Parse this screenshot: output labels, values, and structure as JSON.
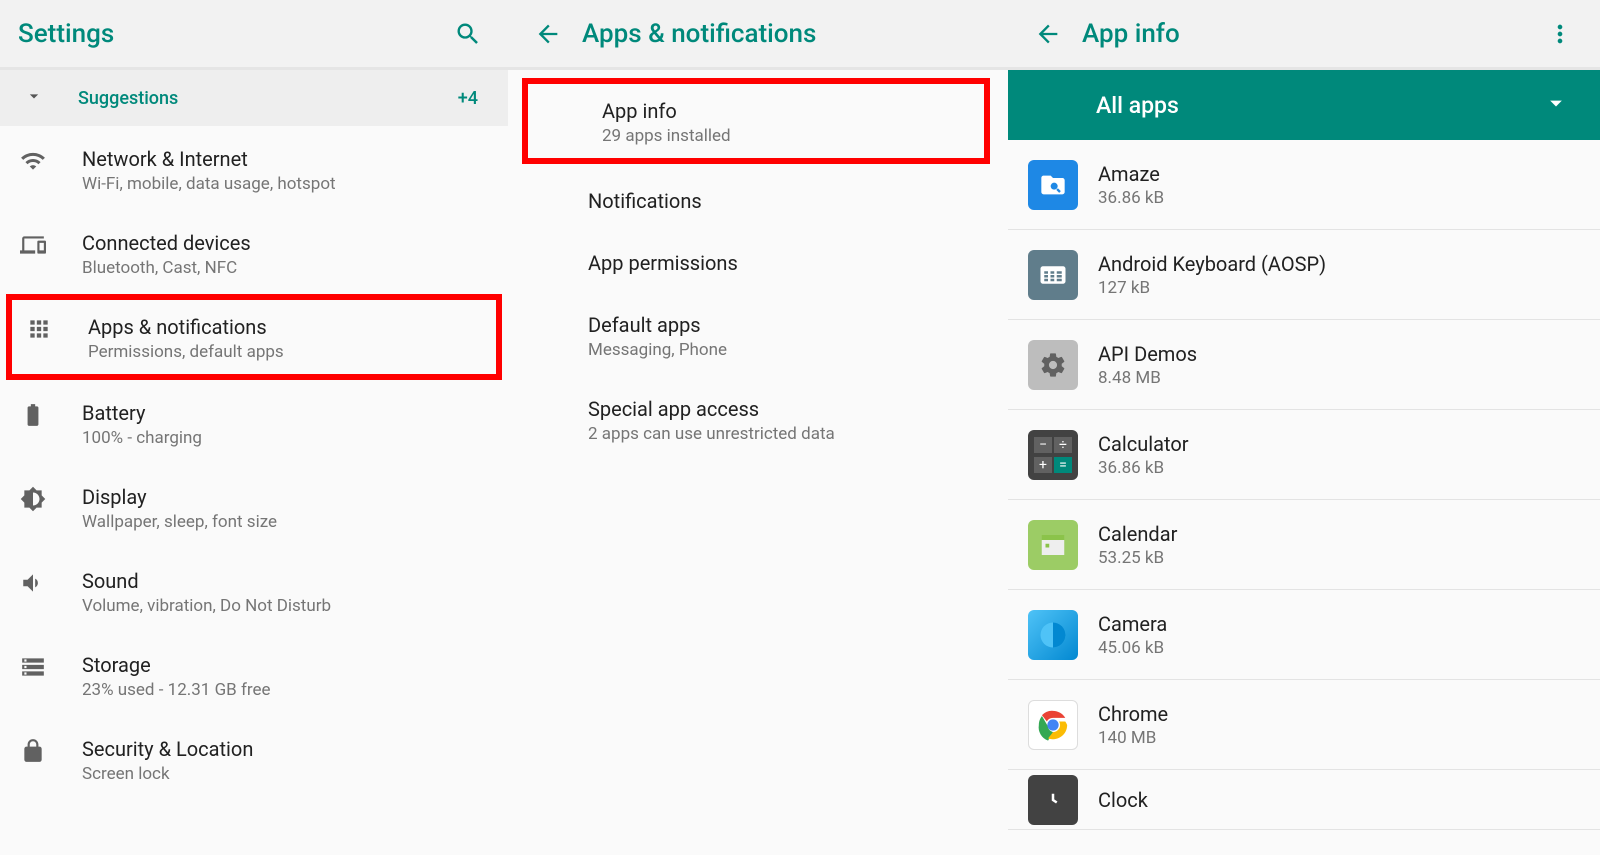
{
  "panel1": {
    "title": "Settings",
    "suggestions_label": "Suggestions",
    "suggestions_count": "+4",
    "items": [
      {
        "title": "Network & Internet",
        "sub": "Wi-Fi, mobile, data usage, hotspot"
      },
      {
        "title": "Connected devices",
        "sub": "Bluetooth, Cast, NFC"
      },
      {
        "title": "Apps & notifications",
        "sub": "Permissions, default apps"
      },
      {
        "title": "Battery",
        "sub": "100% - charging"
      },
      {
        "title": "Display",
        "sub": "Wallpaper, sleep, font size"
      },
      {
        "title": "Sound",
        "sub": "Volume, vibration, Do Not Disturb"
      },
      {
        "title": "Storage",
        "sub": "23% used - 12.31 GB free"
      },
      {
        "title": "Security & Location",
        "sub": "Screen lock"
      }
    ]
  },
  "panel2": {
    "title": "Apps & notifications",
    "items": [
      {
        "title": "App info",
        "sub": "29 apps installed"
      },
      {
        "title": "Notifications",
        "sub": ""
      },
      {
        "title": "App permissions",
        "sub": ""
      },
      {
        "title": "Default apps",
        "sub": "Messaging, Phone"
      },
      {
        "title": "Special app access",
        "sub": "2 apps can use unrestricted data"
      }
    ]
  },
  "panel3": {
    "title": "App info",
    "filter": "All apps",
    "apps": [
      {
        "name": "Amaze",
        "size": "36.86 kB"
      },
      {
        "name": "Android Keyboard (AOSP)",
        "size": "127 kB"
      },
      {
        "name": "API Demos",
        "size": "8.48 MB"
      },
      {
        "name": "Calculator",
        "size": "36.86 kB"
      },
      {
        "name": "Calendar",
        "size": "53.25 kB"
      },
      {
        "name": "Camera",
        "size": "45.06 kB"
      },
      {
        "name": "Chrome",
        "size": "140 MB"
      },
      {
        "name": "Clock",
        "size": ""
      }
    ]
  }
}
